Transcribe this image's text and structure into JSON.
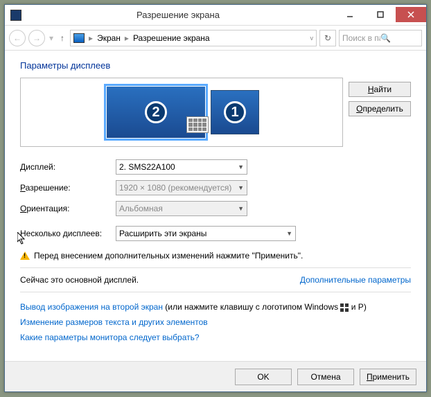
{
  "window": {
    "title": "Разрешение экрана"
  },
  "nav": {
    "crumb1": "Экран",
    "crumb2": "Разрешение экрана",
    "search_placeholder": "Поиск в пане..."
  },
  "heading": "Параметры дисплеев",
  "monitors": {
    "m1_num": "1",
    "m2_num": "2"
  },
  "side": {
    "find": "Найти",
    "identify": "Определить"
  },
  "labels": {
    "display": "Дисплей:",
    "resolution": "Разрешение:",
    "orientation": "Ориентация:",
    "multi": "Несколько дисплеев:"
  },
  "values": {
    "display": "2. SMS22A100",
    "resolution": "1920 × 1080 (рекомендуется)",
    "orientation": "Альбомная",
    "multi": "Расширить эти экраны"
  },
  "warning": "Перед внесением дополнительных изменений нажмите \"Применить\".",
  "maintext": "Сейчас это основной дисплей.",
  "advanced": "Дополнительные параметры",
  "links": {
    "project1": "Вывод изображения на второй экран",
    "project2_a": " (или нажмите клавишу с логотипом Windows ",
    "project2_b": " и P)",
    "textsize": "Изменение размеров текста и других элементов",
    "which": "Какие параметры монитора следует выбрать?"
  },
  "footer": {
    "ok": "OK",
    "cancel": "Отмена",
    "apply": "Применить"
  }
}
